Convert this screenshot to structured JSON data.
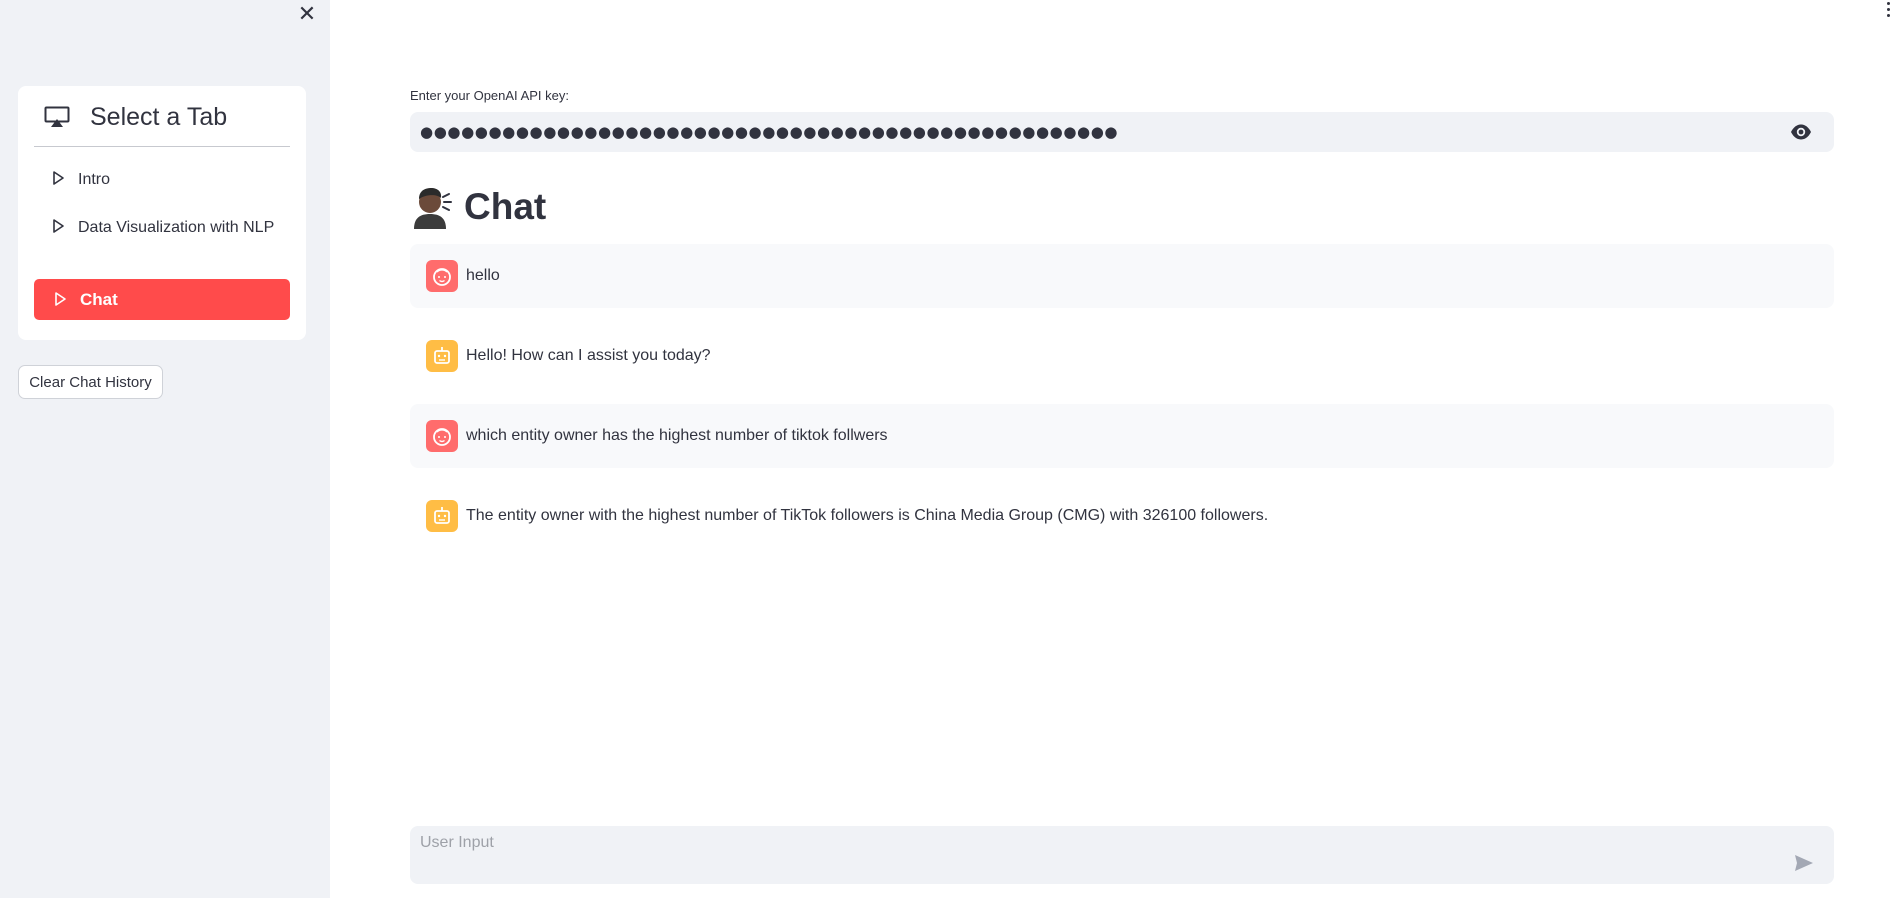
{
  "sidebar": {
    "close_icon": "close-icon",
    "menu": {
      "title": "Select a Tab",
      "title_icon": "airplay-screen-icon",
      "items": [
        {
          "label": "Intro",
          "icon": "play-triangle-icon",
          "active": false
        },
        {
          "label": "Data Visualization with NLP",
          "icon": "play-triangle-icon",
          "active": false
        },
        {
          "label": "Chat",
          "icon": "play-triangle-icon",
          "active": true
        }
      ]
    },
    "clear_button_label": "Clear Chat History"
  },
  "main": {
    "api_key": {
      "label": "Enter your OpenAI API key:",
      "masked_value": "●●●●●●●●●●●●●●●●●●●●●●●●●●●●●●●●●●●●●●●●●●●●●●●●●●●",
      "visibility_icon": "eye-icon"
    },
    "chat_title": "Chat",
    "chat_title_icon": "person-speaking-emoji",
    "messages": [
      {
        "role": "user",
        "avatar_icon": "user-face-icon",
        "text": "hello"
      },
      {
        "role": "assistant",
        "avatar_icon": "robot-icon",
        "text": "Hello! How can I assist you today?"
      },
      {
        "role": "user",
        "avatar_icon": "user-face-icon",
        "text": "which entity owner has the highest number of tiktok follwers"
      },
      {
        "role": "assistant",
        "avatar_icon": "robot-icon",
        "text": "The entity owner with the highest number of TikTok followers is China Media Group (CMG) with 326100 followers."
      }
    ],
    "chat_input": {
      "placeholder": "User Input",
      "value": "",
      "send_icon": "send-icon"
    }
  },
  "colors": {
    "accent": "#ff4b4b",
    "sidebar_bg": "#f0f2f6",
    "user_avatar": "#ff6c6c",
    "bot_avatar": "#ffbd45",
    "text": "#31333f"
  }
}
